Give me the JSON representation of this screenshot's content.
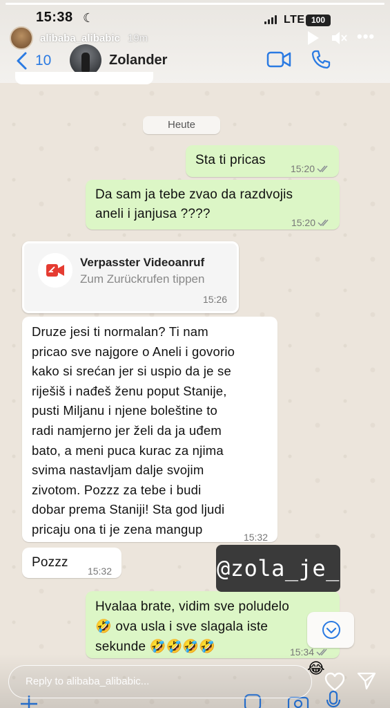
{
  "story": {
    "progress": 1.0,
    "username": "alibaba_alibabic",
    "posted_ago": "19m",
    "controls": {
      "play": "play-icon",
      "mute": "mute-icon",
      "more": "•••"
    }
  },
  "status_bar": {
    "time": "15:38",
    "dnd_icon": "moon-icon",
    "network": "LTE",
    "battery": "100"
  },
  "chat_header": {
    "back_count": "10",
    "contact_name": "Zolander",
    "icons": [
      "video-call-icon",
      "phone-call-icon"
    ]
  },
  "day_label": "Heute",
  "messages": [
    {
      "text": "Sta ti pricas",
      "time": "15:20",
      "direction": "out",
      "read": true
    },
    {
      "text": "Da sam ja tebe zvao da razdvojis\naneli i janjusa ????",
      "time": "15:20",
      "direction": "out",
      "read": true
    },
    {
      "text": "Druze jesi ti normalan? Ti nam\npricao sve najgore o Aneli i govorio\nkako si srećan jer si uspio da je se\nriješiš i nađeš ženu poput Stanije,\npusti Miljanu i njene boleštine to\nradi namjerno jer želi da ja uđem\nbato, a meni puca kurac za njima\nsvima nastavljam dalje svojim\nzivotom. Pozzz za tebe i budi\ndobar prema Staniji! Sta god ljudi\npricaju ona ti je zena mangup",
      "time": "15:32",
      "direction": "in"
    },
    {
      "text": "Pozzz",
      "time": "15:32",
      "direction": "in"
    },
    {
      "text": "Hvalaa brate, vidim sve poludelo\n🤣 ova usla i sve slagala iste\nsekunde 🤣🤣🤣🤣",
      "time": "15:34",
      "direction": "out",
      "read": true
    }
  ],
  "missed_call": {
    "title": "Verpasster Videoanruf",
    "subtitle": "Zum Zurückrufen tippen",
    "time": "15:26"
  },
  "overlay_tag": "@zola_je_",
  "reply": {
    "placeholder": "Reply to alibaba_alibabic...",
    "reaction_emoji": "😂"
  },
  "colors": {
    "accent": "#2a7ae2",
    "outgoing_bubble": "#dcf6c6",
    "incoming_bubble": "#ffffff",
    "missed_call_red": "#e53c32",
    "chat_background": "#ece5dc"
  }
}
